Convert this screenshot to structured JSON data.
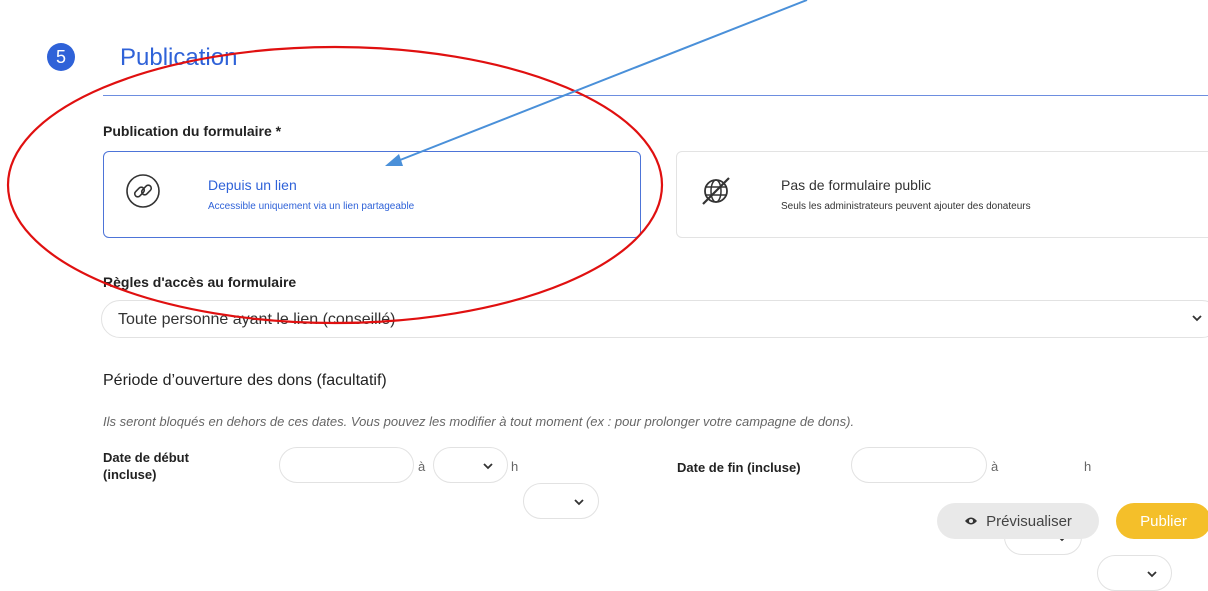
{
  "section": {
    "step_number": "5",
    "title": "Publication"
  },
  "publication": {
    "label": "Publication du formulaire *",
    "options": [
      {
        "title": "Depuis un lien",
        "subtitle": "Accessible uniquement via un lien partageable",
        "icon": "link-icon",
        "selected": true
      },
      {
        "title": "Pas de formulaire public",
        "subtitle": "Seuls les administrateurs peuvent ajouter des donateurs",
        "icon": "globe-disabled-icon",
        "selected": false
      }
    ]
  },
  "access_rules": {
    "label": "Règles d'accès au formulaire",
    "selected_value": "Toute personne ayant le lien (conseillé)"
  },
  "period": {
    "title": "Période d’ouverture des dons (facultatif)",
    "hint": "Ils seront bloqués en dehors de ces dates. Vous pouvez les modifier à tout moment (ex : pour prolonger votre campagne de dons).",
    "start_label_line1": "Date de début",
    "start_label_line2": "(incluse)",
    "end_label": "Date de fin (incluse)",
    "at_separator": "à",
    "hour_separator": "h"
  },
  "actions": {
    "preview_label": "Prévisualiser",
    "publish_label": "Publier"
  },
  "colors": {
    "accent": "#2f62d8",
    "publish": "#f4bf2a",
    "annotation_circle": "#e01010",
    "annotation_arrow": "#4a90d9"
  }
}
